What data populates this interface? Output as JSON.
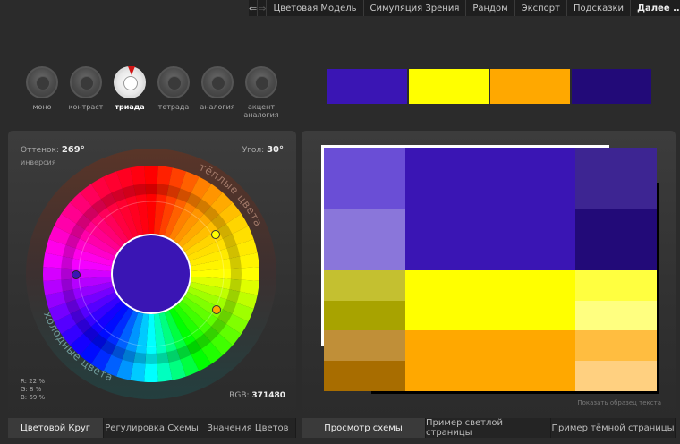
{
  "nav": {
    "back_icon": "arrow-left-icon",
    "forward_icon": "arrow-right-icon",
    "menu": [
      "Цветовая Модель",
      "Симуляция Зрения",
      "Рандом",
      "Экспорт",
      "Подсказки",
      "Далее ..."
    ]
  },
  "modes": [
    {
      "label": "моно",
      "active": false
    },
    {
      "label": "контраст",
      "active": false
    },
    {
      "label": "триада",
      "active": true
    },
    {
      "label": "тетрада",
      "active": false
    },
    {
      "label": "аналогия",
      "active": false
    },
    {
      "label": "акцент аналогия",
      "active": false
    }
  ],
  "palette": [
    "#3a15b4",
    "#ffff00",
    "#ffa800",
    "#220a78"
  ],
  "wheel": {
    "hue_label": "Оттенок:",
    "hue_value": "269°",
    "angle_label": "Угол:",
    "angle_value": "30°",
    "invert_label": "инверсия",
    "warm_label": "тёплые цвета",
    "cool_label": "холодные цвета",
    "center_color": "#3a15b4",
    "rgb_lines": [
      "R: 22 %",
      "G:  8 %",
      "B: 69 %"
    ],
    "rgb_label": "RGB:",
    "rgb_value": "371480"
  },
  "left_tabs": [
    "Цветовой Круг",
    "Регулировка Схемы",
    "Значения Цветов"
  ],
  "right_tabs": [
    "Просмотр схемы",
    "Пример светлой страницы",
    "Пример тёмной страницы"
  ],
  "preview": {
    "show_sample_text": "Показать образец текста",
    "colors": {
      "primary_main": "#3a15b4",
      "primary_light1": "#6a4ed6",
      "primary_light2": "#8a76da",
      "primary_dark1": "#3d2592",
      "primary_dark2": "#220a78",
      "yellow_main": "#ffff00",
      "yellow_dark1": "#c4c030",
      "yellow_dark2": "#a8a300",
      "yellow_light1": "#ffff40",
      "yellow_light2": "#ffff80",
      "orange_main": "#ffa800",
      "orange_dark1": "#c08f38",
      "orange_dark2": "#a86d00",
      "orange_light1": "#ffbd40",
      "orange_light2": "#ffd080"
    }
  }
}
